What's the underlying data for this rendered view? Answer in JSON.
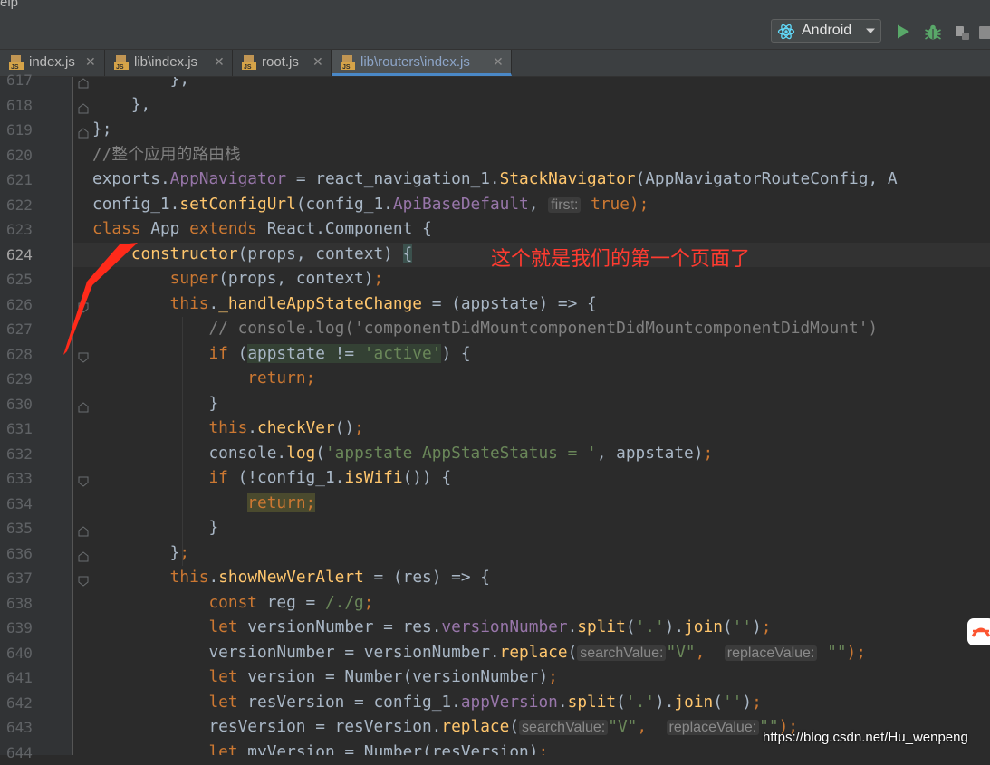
{
  "menu": {
    "partial_label": "elp"
  },
  "toolbar": {
    "device_label": "Android",
    "icons": [
      "react-logo-icon",
      "chevron-down-icon",
      "run-icon",
      "debug-icon",
      "attach-debugger-icon",
      "stop-icon"
    ]
  },
  "tabs": [
    {
      "label": "index.js",
      "active": false
    },
    {
      "label": "lib\\index.js",
      "active": false
    },
    {
      "label": "root.js",
      "active": false
    },
    {
      "label": "lib\\routers\\index.js",
      "active": true
    }
  ],
  "gutter": {
    "line_numbers": [
      "617",
      "618",
      "619",
      "620",
      "621",
      "622",
      "623",
      "624",
      "625",
      "626",
      "627",
      "628",
      "629",
      "630",
      "631",
      "632",
      "633",
      "634",
      "635",
      "636",
      "637",
      "638",
      "639",
      "640",
      "641",
      "642",
      "643",
      "644"
    ],
    "current_line": "624"
  },
  "code_lines": [
    [
      {
        "t": "        },",
        "c": ""
      }
    ],
    [
      {
        "t": "    },",
        "c": ""
      }
    ],
    [
      {
        "t": "};",
        "c": ""
      }
    ],
    [
      {
        "t": "//整个应用的路由栈",
        "c": "cm"
      }
    ],
    [
      {
        "t": "exports",
        "c": ""
      },
      {
        "t": ".",
        "c": ""
      },
      {
        "t": "AppNavigator",
        "c": "pr"
      },
      {
        "t": " = react_navigation_1.",
        "c": ""
      },
      {
        "t": "StackNavigator",
        "c": "fn"
      },
      {
        "t": "(AppNavigatorRouteConfig, A",
        "c": ""
      }
    ],
    [
      {
        "t": "config_1.",
        "c": ""
      },
      {
        "t": "setConfigUrl",
        "c": "fn"
      },
      {
        "t": "(config_1.",
        "c": ""
      },
      {
        "t": "ApiBaseDefault",
        "c": "pr"
      },
      {
        "t": ", ",
        "c": ""
      },
      {
        "t": "first:",
        "c": "hint"
      },
      {
        "t": " ",
        "c": ""
      },
      {
        "t": "true",
        "c": "kw"
      },
      {
        "t": ");",
        "c": "kw"
      }
    ],
    [
      {
        "t": "class",
        "c": "kw"
      },
      {
        "t": " App ",
        "c": ""
      },
      {
        "t": "extends",
        "c": "kw"
      },
      {
        "t": " React.Component {",
        "c": ""
      }
    ],
    [
      {
        "t": "    ",
        "c": ""
      },
      {
        "t": "constructor",
        "c": "fn"
      },
      {
        "t": "(props, context) ",
        "c": ""
      },
      {
        "t": "{",
        "c": "br"
      }
    ],
    [
      {
        "t": "        ",
        "c": ""
      },
      {
        "t": "super",
        "c": "kw"
      },
      {
        "t": "(props, context)",
        "c": ""
      },
      {
        "t": ";",
        "c": "kw"
      }
    ],
    [
      {
        "t": "        ",
        "c": ""
      },
      {
        "t": "this",
        "c": "kw"
      },
      {
        "t": ".",
        "c": ""
      },
      {
        "t": "_handleAppStateChange",
        "c": "fn"
      },
      {
        "t": " = (appstate) => {",
        "c": ""
      }
    ],
    [
      {
        "t": "            // console.log('componentDidMountcomponentDidMountcomponentDidMount')",
        "c": "cm"
      }
    ],
    [
      {
        "t": "            ",
        "c": ""
      },
      {
        "t": "if",
        "c": "kw"
      },
      {
        "t": " (",
        "c": ""
      },
      {
        "t": "appstate != ",
        "c": "hl"
      },
      {
        "t": "'active'",
        "c": "str hl"
      },
      {
        "t": ") {",
        "c": ""
      }
    ],
    [
      {
        "t": "                ",
        "c": ""
      },
      {
        "t": "return",
        "c": "kw"
      },
      {
        "t": ";",
        "c": "kw"
      }
    ],
    [
      {
        "t": "            }",
        "c": ""
      }
    ],
    [
      {
        "t": "            ",
        "c": ""
      },
      {
        "t": "this",
        "c": "kw"
      },
      {
        "t": ".",
        "c": ""
      },
      {
        "t": "checkVer",
        "c": "fn"
      },
      {
        "t": "()",
        "c": ""
      },
      {
        "t": ";",
        "c": "kw"
      }
    ],
    [
      {
        "t": "            console.",
        "c": ""
      },
      {
        "t": "log",
        "c": "fn"
      },
      {
        "t": "(",
        "c": ""
      },
      {
        "t": "'appstate AppStateStatus = '",
        "c": "str"
      },
      {
        "t": ", appstate)",
        "c": ""
      },
      {
        "t": ";",
        "c": "kw"
      }
    ],
    [
      {
        "t": "            ",
        "c": ""
      },
      {
        "t": "if",
        "c": "kw"
      },
      {
        "t": " (!config_1.",
        "c": ""
      },
      {
        "t": "isWifi",
        "c": "fn"
      },
      {
        "t": "()) {",
        "c": ""
      }
    ],
    [
      {
        "t": "                ",
        "c": ""
      },
      {
        "t": "return;",
        "c": "kw hlm"
      }
    ],
    [
      {
        "t": "            }",
        "c": ""
      }
    ],
    [
      {
        "t": "        }",
        "c": ""
      },
      {
        "t": ";",
        "c": "kw"
      }
    ],
    [
      {
        "t": "        ",
        "c": ""
      },
      {
        "t": "this",
        "c": "kw"
      },
      {
        "t": ".",
        "c": ""
      },
      {
        "t": "showNewVerAlert",
        "c": "fn"
      },
      {
        "t": " = (res) => {",
        "c": ""
      }
    ],
    [
      {
        "t": "            ",
        "c": ""
      },
      {
        "t": "const",
        "c": "kw"
      },
      {
        "t": " reg = ",
        "c": ""
      },
      {
        "t": "/./g",
        "c": "str"
      },
      {
        "t": ";",
        "c": "kw"
      }
    ],
    [
      {
        "t": "            ",
        "c": ""
      },
      {
        "t": "let",
        "c": "kw"
      },
      {
        "t": " versionNumber = res.",
        "c": ""
      },
      {
        "t": "versionNumber",
        "c": "pr"
      },
      {
        "t": ".",
        "c": ""
      },
      {
        "t": "split",
        "c": "fn"
      },
      {
        "t": "(",
        "c": ""
      },
      {
        "t": "'.'",
        "c": "str"
      },
      {
        "t": ").",
        "c": ""
      },
      {
        "t": "join",
        "c": "fn"
      },
      {
        "t": "(",
        "c": ""
      },
      {
        "t": "''",
        "c": "str"
      },
      {
        "t": ")",
        "c": ""
      },
      {
        "t": ";",
        "c": "kw"
      }
    ],
    [
      {
        "t": "            versionNumber = versionNumber.",
        "c": ""
      },
      {
        "t": "replace",
        "c": "fn"
      },
      {
        "t": "(",
        "c": ""
      },
      {
        "t": "searchValue:",
        "c": "hint"
      },
      {
        "t": "\"V\"",
        "c": "str"
      },
      {
        "t": ",  ",
        "c": "kw"
      },
      {
        "t": "replaceValue:",
        "c": "hint"
      },
      {
        "t": " ",
        "c": ""
      },
      {
        "t": "\"\"",
        "c": "str"
      },
      {
        "t": ");",
        "c": "kw"
      }
    ],
    [
      {
        "t": "            ",
        "c": ""
      },
      {
        "t": "let",
        "c": "kw"
      },
      {
        "t": " version = Number(versionNumber)",
        "c": ""
      },
      {
        "t": ";",
        "c": "kw"
      }
    ],
    [
      {
        "t": "            ",
        "c": ""
      },
      {
        "t": "let",
        "c": "kw"
      },
      {
        "t": " resVersion = config_1.",
        "c": ""
      },
      {
        "t": "appVersion",
        "c": "pr"
      },
      {
        "t": ".",
        "c": ""
      },
      {
        "t": "split",
        "c": "fn"
      },
      {
        "t": "(",
        "c": ""
      },
      {
        "t": "'.'",
        "c": "str"
      },
      {
        "t": ").",
        "c": ""
      },
      {
        "t": "join",
        "c": "fn"
      },
      {
        "t": "(",
        "c": ""
      },
      {
        "t": "''",
        "c": "str"
      },
      {
        "t": ")",
        "c": ""
      },
      {
        "t": ";",
        "c": "kw"
      }
    ],
    [
      {
        "t": "            resVersion = resVersion.",
        "c": ""
      },
      {
        "t": "replace",
        "c": "fn"
      },
      {
        "t": "(",
        "c": ""
      },
      {
        "t": "searchValue:",
        "c": "hint"
      },
      {
        "t": "\"V\"",
        "c": "str"
      },
      {
        "t": ",  ",
        "c": "kw"
      },
      {
        "t": "replaceValue:",
        "c": "hint"
      },
      {
        "t": "\"\"",
        "c": "str"
      },
      {
        "t": ");",
        "c": "kw"
      }
    ],
    [
      {
        "t": "            ",
        "c": ""
      },
      {
        "t": "let",
        "c": "kw"
      },
      {
        "t": " myVersion = Number(resVersion)",
        "c": ""
      },
      {
        "t": ";",
        "c": "kw"
      }
    ]
  ],
  "annotation": {
    "text": "这个就是我们的第一个页面了",
    "color": "#ff3b30"
  },
  "watermark": {
    "text": "https://blog.csdn.net/Hu_wenpeng"
  },
  "side_badge": {
    "icon": "csdn-logo-icon"
  }
}
